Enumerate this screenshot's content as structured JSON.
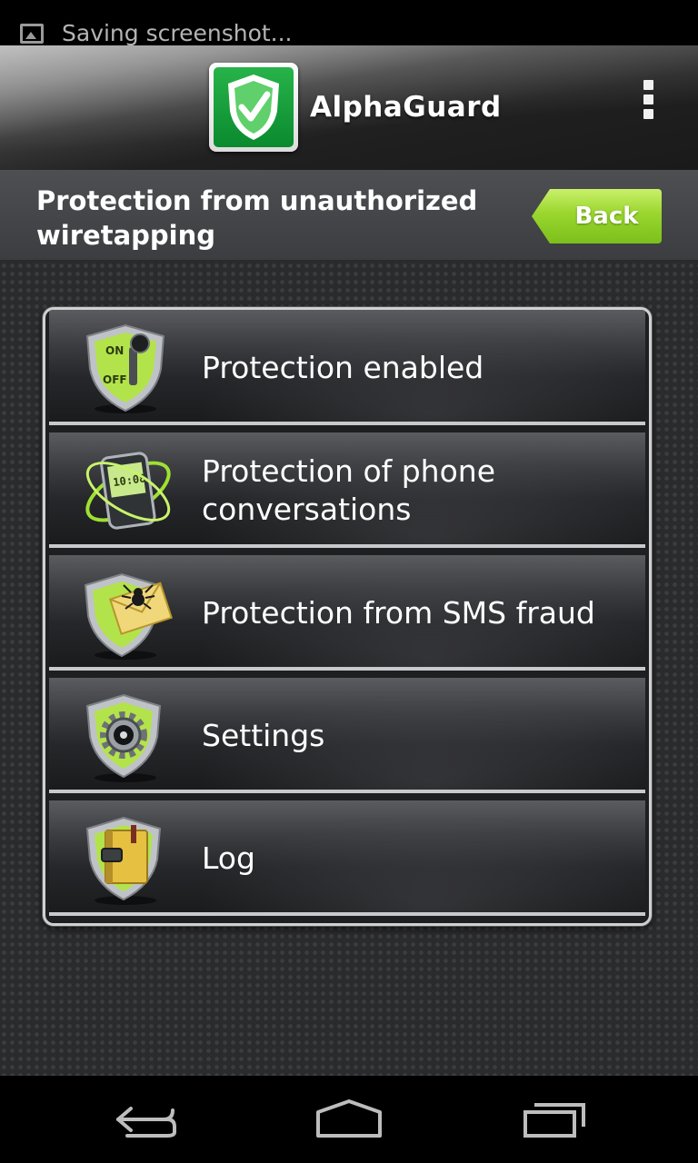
{
  "status_bar": {
    "notification_text": "Saving screenshot...",
    "notification_icon": "image-icon"
  },
  "app_bar": {
    "title": "AlphaGuard",
    "logo_icon": "shield-check-icon",
    "menu_icon": "overflow-menu-icon"
  },
  "sub_header": {
    "title": "Protection from unauthorized wiretapping",
    "back_label": "Back"
  },
  "menu": {
    "items": [
      {
        "label": "Protection enabled",
        "icon": "on-off-shield-icon"
      },
      {
        "label": "Protection of phone conversations",
        "icon": "phone-orbit-icon"
      },
      {
        "label": "Protection from SMS fraud",
        "icon": "sms-spider-shield-icon"
      },
      {
        "label": "Settings",
        "icon": "gear-shield-icon"
      },
      {
        "label": "Log",
        "icon": "book-shield-icon"
      }
    ]
  },
  "nav_bar": {
    "back_icon": "back-arrow-icon",
    "home_icon": "home-icon",
    "recents_icon": "recent-apps-icon"
  },
  "colors": {
    "accent_green": "#9ad62e",
    "logo_green": "#19a03c",
    "shield_green": "#b6e84a"
  }
}
